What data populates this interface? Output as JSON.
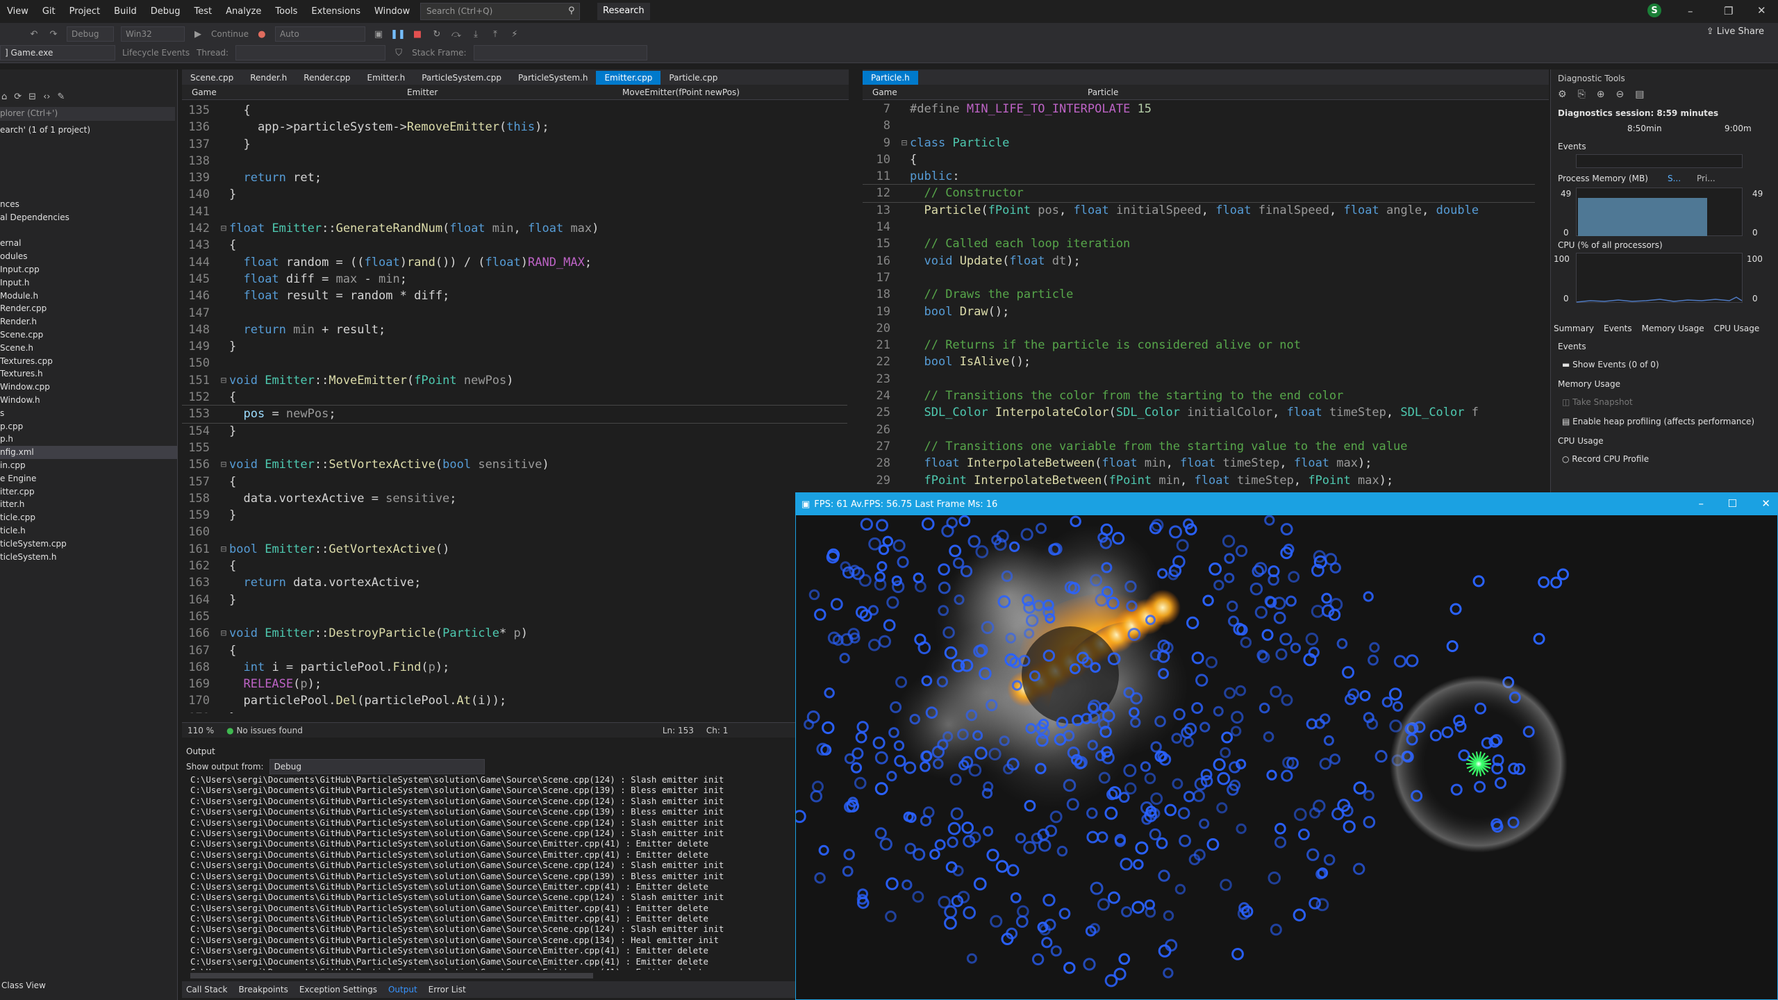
{
  "menu": {
    "items": [
      "View",
      "Git",
      "Project",
      "Build",
      "Debug",
      "Test",
      "Analyze",
      "Tools",
      "Extensions",
      "Window",
      "Help"
    ],
    "search_placeholder": "Search (Ctrl+Q)",
    "research": "Research",
    "avatar_letter": "S"
  },
  "toolbar": {
    "config": "Debug",
    "platform": "Win32",
    "continue": "Continue",
    "auto": "Auto",
    "process": "] Game.exe",
    "lifecycle": "Lifecycle Events",
    "thread": "Thread:",
    "stack_frame": "Stack Frame:",
    "live_share": "Live Share"
  },
  "solution": {
    "search": "plorer (Ctrl+')",
    "title": "earch' (1 of 1 project)",
    "items": [
      "nces",
      "al Dependencies",
      "",
      "ernal",
      "odules",
      "Input.cpp",
      "Input.h",
      "Module.h",
      "Render.cpp",
      "Render.h",
      "Scene.cpp",
      "Scene.h",
      "Textures.cpp",
      "Textures.h",
      "Window.cpp",
      "Window.h",
      "s",
      "p.cpp",
      "p.h",
      "nfig.xml",
      "in.cpp",
      "e Engine",
      "itter.cpp",
      "itter.h",
      "ticle.cpp",
      "ticle.h",
      "ticleSystem.cpp",
      "ticleSystem.h"
    ],
    "selected_index": 19,
    "class_view": "Class View"
  },
  "left_editor": {
    "tabs": [
      "Scene.cpp",
      "Render.h",
      "Render.cpp",
      "Emitter.h",
      "ParticleSystem.cpp",
      "ParticleSystem.h",
      "Emitter.cpp",
      "Particle.cpp"
    ],
    "active_tab": 6,
    "nav": {
      "project": "Game",
      "scope": "Emitter",
      "member": "MoveEmitter(fPoint newPos)"
    },
    "zoom": "110 %",
    "issues": "No issues found",
    "ln": "Ln: 153",
    "ch": "Ch: 1"
  },
  "right_editor": {
    "tabs": [
      "Particle.h"
    ],
    "nav": {
      "project": "Game",
      "scope": "Particle"
    }
  },
  "output": {
    "title": "Output",
    "show_from_label": "Show output from:",
    "show_from_value": "Debug",
    "lines": [
      "C:\\Users\\sergi\\Documents\\GitHub\\ParticleSystem\\solution\\Game\\Source\\Scene.cpp(124) : Slash emitter init",
      "C:\\Users\\sergi\\Documents\\GitHub\\ParticleSystem\\solution\\Game\\Source\\Scene.cpp(139) : Bless emitter init",
      "C:\\Users\\sergi\\Documents\\GitHub\\ParticleSystem\\solution\\Game\\Source\\Scene.cpp(124) : Slash emitter init",
      "C:\\Users\\sergi\\Documents\\GitHub\\ParticleSystem\\solution\\Game\\Source\\Scene.cpp(139) : Bless emitter init",
      "C:\\Users\\sergi\\Documents\\GitHub\\ParticleSystem\\solution\\Game\\Source\\Scene.cpp(124) : Slash emitter init",
      "C:\\Users\\sergi\\Documents\\GitHub\\ParticleSystem\\solution\\Game\\Source\\Scene.cpp(124) : Slash emitter init",
      "C:\\Users\\sergi\\Documents\\GitHub\\ParticleSystem\\solution\\Game\\Source\\Emitter.cpp(41) : Emitter delete",
      "C:\\Users\\sergi\\Documents\\GitHub\\ParticleSystem\\solution\\Game\\Source\\Emitter.cpp(41) : Emitter delete",
      "C:\\Users\\sergi\\Documents\\GitHub\\ParticleSystem\\solution\\Game\\Source\\Scene.cpp(124) : Slash emitter init",
      "C:\\Users\\sergi\\Documents\\GitHub\\ParticleSystem\\solution\\Game\\Source\\Scene.cpp(139) : Bless emitter init",
      "C:\\Users\\sergi\\Documents\\GitHub\\ParticleSystem\\solution\\Game\\Source\\Emitter.cpp(41) : Emitter delete",
      "C:\\Users\\sergi\\Documents\\GitHub\\ParticleSystem\\solution\\Game\\Source\\Scene.cpp(124) : Slash emitter init",
      "C:\\Users\\sergi\\Documents\\GitHub\\ParticleSystem\\solution\\Game\\Source\\Emitter.cpp(41) : Emitter delete",
      "C:\\Users\\sergi\\Documents\\GitHub\\ParticleSystem\\solution\\Game\\Source\\Emitter.cpp(41) : Emitter delete",
      "C:\\Users\\sergi\\Documents\\GitHub\\ParticleSystem\\solution\\Game\\Source\\Scene.cpp(124) : Slash emitter init",
      "C:\\Users\\sergi\\Documents\\GitHub\\ParticleSystem\\solution\\Game\\Source\\Scene.cpp(134) : Heal emitter init",
      "C:\\Users\\sergi\\Documents\\GitHub\\ParticleSystem\\solution\\Game\\Source\\Emitter.cpp(41) : Emitter delete",
      "C:\\Users\\sergi\\Documents\\GitHub\\ParticleSystem\\solution\\Game\\Source\\Emitter.cpp(41) : Emitter delete",
      "C:\\Users\\sergi\\Documents\\GitHub\\ParticleSystem\\solution\\Game\\Source\\Emitter.cpp(41) : Emitter delete",
      "C:\\Users\\sergi\\Documents\\GitHub\\ParticleSystem\\solution\\Game\\Source\\Emitter.cpp(41) : Emitter delete"
    ]
  },
  "bottom_tabs": [
    "Call Stack",
    "Breakpoints",
    "Exception Settings",
    "Output",
    "Error List"
  ],
  "bottom_active": 3,
  "diagnostics": {
    "title": "Diagnostic Tools",
    "session": "Diagnostics session: 8:59 minutes",
    "time_a": "8:50min",
    "time_b": "9:00m",
    "events": "Events",
    "process_memory": "Process Memory (MB)",
    "legend_s": "S...",
    "legend_pri": "Pri...",
    "mem_max": "49",
    "mem_min": "0",
    "cpu": "CPU (% of all processors)",
    "cpu_max": "100",
    "cpu_min": "0",
    "tabs": [
      "Summary",
      "Events",
      "Memory Usage",
      "CPU Usage"
    ],
    "events_header": "Events",
    "show_events": "Show Events (0 of 0)",
    "memory_header": "Memory Usage",
    "take_snapshot": "Take Snapshot",
    "heap_profiling": "Enable heap profiling (affects performance)",
    "cpu_header": "CPU Usage",
    "record_cpu": "Record CPU Profile"
  },
  "game": {
    "title": "FPS: 61 Av.FPS: 56.75 Last Frame Ms: 16"
  },
  "colors": {
    "accent": "#007acc",
    "game_title": "#1ba1e2",
    "particle_blue": "#2a62ff",
    "heal_green": "#39ff6a"
  }
}
